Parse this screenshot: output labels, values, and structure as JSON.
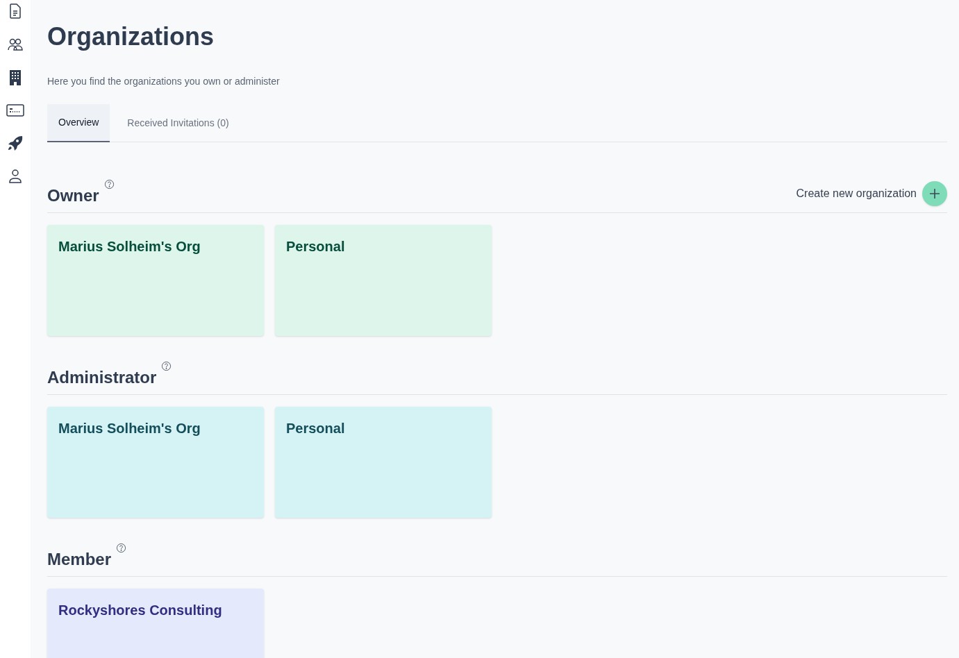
{
  "title": "Organizations",
  "subtitle": "Here you find the organizations you own or administer",
  "tabs": [
    {
      "label": "Overview",
      "selected": true
    },
    {
      "label": "Received Invitations (0)",
      "selected": false
    }
  ],
  "sections": [
    {
      "kind": "owner",
      "heading": "Owner",
      "action": "Create new organization",
      "cards": [
        "Marius Solheim's Org",
        "Personal"
      ]
    },
    {
      "kind": "administrator",
      "heading": "Administrator",
      "cards": [
        "Marius Solheim's Org",
        "Personal"
      ]
    },
    {
      "kind": "member",
      "heading": "Member",
      "cards": [
        "Rockyshores Consulting"
      ]
    }
  ]
}
